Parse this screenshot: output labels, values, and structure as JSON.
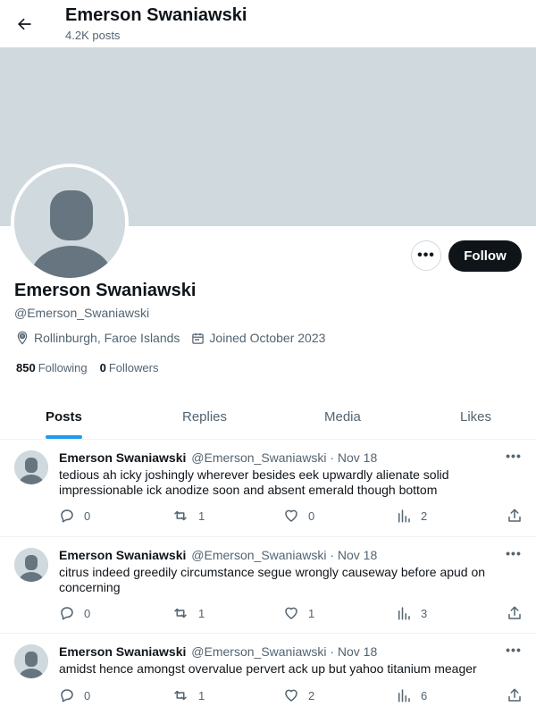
{
  "header": {
    "title": "Emerson Swaniawski",
    "post_count": "4.2K posts"
  },
  "profile": {
    "name": "Emerson Swaniawski",
    "handle": "@Emerson_Swaniawski",
    "location": "Rollinburgh, Faroe Islands",
    "joined": "Joined October 2023",
    "following_count": "850",
    "following_label": "Following",
    "followers_count": "0",
    "followers_label": "Followers",
    "more_label": "•••",
    "follow_label": "Follow"
  },
  "tabs": [
    {
      "label": "Posts",
      "active": true
    },
    {
      "label": "Replies",
      "active": false
    },
    {
      "label": "Media",
      "active": false
    },
    {
      "label": "Likes",
      "active": false
    }
  ],
  "posts": [
    {
      "name": "Emerson Swaniawski",
      "handle": "@Emerson_Swaniawski · Nov 18",
      "text": "tedious ah icky joshingly wherever besides eek upwardly alienate solid impressionable ick anodize soon and absent emerald though bottom",
      "replies": "0",
      "reposts": "1",
      "likes": "0",
      "views": "2"
    },
    {
      "name": "Emerson Swaniawski",
      "handle": "@Emerson_Swaniawski · Nov 18",
      "text": "citrus indeed greedily circumstance segue wrongly causeway before apud on concerning",
      "replies": "0",
      "reposts": "1",
      "likes": "1",
      "views": "3"
    },
    {
      "name": "Emerson Swaniawski",
      "handle": "@Emerson_Swaniawski · Nov 18",
      "text": "amidst hence amongst overvalue pervert ack up but yahoo titanium meager",
      "replies": "0",
      "reposts": "1",
      "likes": "2",
      "views": "6"
    }
  ],
  "icons": {
    "back": "arrow-left-icon",
    "location": "location-pin-icon",
    "calendar": "calendar-icon",
    "reply": "reply-icon",
    "repost": "repost-icon",
    "like": "heart-icon",
    "views": "views-icon",
    "share": "share-icon"
  },
  "colors": {
    "accent": "#1d9bf0",
    "banner": "#cfd9de",
    "text": "#0f1419",
    "muted": "#536471",
    "follow_bg": "#0f1419"
  }
}
